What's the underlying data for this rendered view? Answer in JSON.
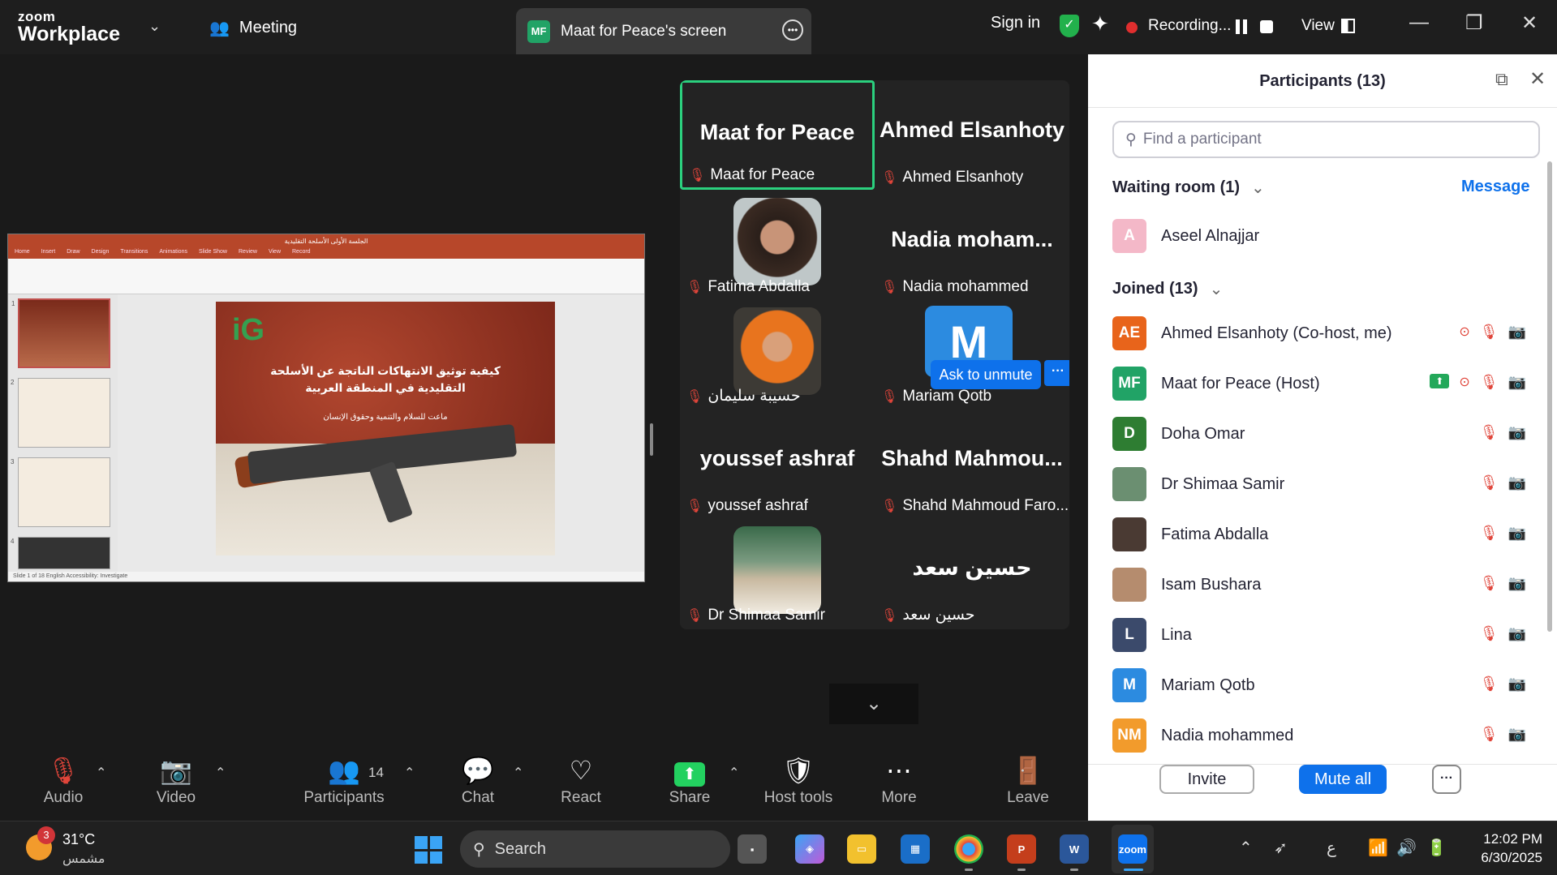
{
  "titlebar": {
    "brand_top": "zoom",
    "brand_bottom": "Workplace",
    "meeting_label": "Meeting",
    "share_tab_initials": "MF",
    "share_tab_title": "Maat for Peace's screen",
    "sign_in": "Sign in",
    "recording_label": "Recording...",
    "view_label": "View"
  },
  "presentation": {
    "window_title": "الجلسة الأولى الأسلحة التقليدية",
    "menu": [
      "Home",
      "Insert",
      "Draw",
      "Design",
      "Transitions",
      "Animations",
      "Slide Show",
      "Review",
      "View",
      "Record"
    ],
    "slide_title": "كيفية توثيق الانتهاكات الناتجة عن الأسلحة التقليدية في المنطقة العربية",
    "slide_subtitle": "ماعت للسلام والتنمية وحقوق الإنسان",
    "slide_logo": "iG",
    "status_bar": "Slide 1 of 18   English   Accessibility: Investigate",
    "thumb_numbers": [
      "1",
      "2",
      "3",
      "4"
    ]
  },
  "gallery": {
    "tiles": [
      {
        "big": "Maat for Peace",
        "name": "Maat for Peace"
      },
      {
        "big": "Ahmed Elsanhoty",
        "name": "Ahmed Elsanhoty"
      },
      {
        "big": "",
        "name": "Fatima Abdalla"
      },
      {
        "big": "Nadia  moham...",
        "name": "Nadia mohammed"
      },
      {
        "big": "",
        "name": "حسيبة سليمان"
      },
      {
        "big": "M",
        "name": "Mariam Qotb"
      },
      {
        "big": "youssef ashraf",
        "name": "youssef ashraf"
      },
      {
        "big": "Shahd  Mahmou...",
        "name": "Shahd Mahmoud Faro..."
      },
      {
        "big": "",
        "name": "Dr Shimaa Samir"
      },
      {
        "big": "حسين سعد",
        "name": "حسين سعد"
      }
    ],
    "ask_to_unmute": "Ask to unmute",
    "more_dots": "···"
  },
  "panel": {
    "title": "Participants (13)",
    "search_placeholder": "Find a participant",
    "waiting_header": "Waiting room (1)",
    "message_link": "Message",
    "waiting": [
      {
        "initials": "A",
        "name": "Aseel Alnajjar",
        "color": "#f4b8c8"
      }
    ],
    "joined_header": "Joined (13)",
    "joined": [
      {
        "initials": "AE",
        "name": "Ahmed Elsanhoty (Co-host, me)",
        "color": "#e8641b"
      },
      {
        "initials": "MF",
        "name": "Maat for Peace (Host)",
        "color": "#21a366"
      },
      {
        "initials": "D",
        "name": "Doha Omar",
        "color": "#2e7d32"
      },
      {
        "initials": "",
        "name": "Dr Shimaa Samir",
        "color": "#6b8f71"
      },
      {
        "initials": "",
        "name": "Fatima Abdalla",
        "color": "#4a3a33"
      },
      {
        "initials": "",
        "name": "Isam Bushara",
        "color": "#b58c6e"
      },
      {
        "initials": "L",
        "name": "Lina",
        "color": "#3b4a6b"
      },
      {
        "initials": "M",
        "name": "Mariam Qotb",
        "color": "#2c8be0"
      },
      {
        "initials": "NM",
        "name": "Nadia mohammed",
        "color": "#f29b2c"
      }
    ],
    "invite": "Invite",
    "mute_all": "Mute all",
    "more": "···"
  },
  "toolbar": {
    "audio": "Audio",
    "video": "Video",
    "participants": "Participants",
    "participants_count": "14",
    "chat": "Chat",
    "react": "React",
    "share": "Share",
    "host_tools": "Host tools",
    "more": "More",
    "leave": "Leave"
  },
  "taskbar": {
    "weather_badge": "3",
    "temperature": "31°C",
    "condition": "مشمس",
    "search": "Search",
    "time": "12:02 PM",
    "date": "6/30/2025",
    "lang": "ع"
  }
}
